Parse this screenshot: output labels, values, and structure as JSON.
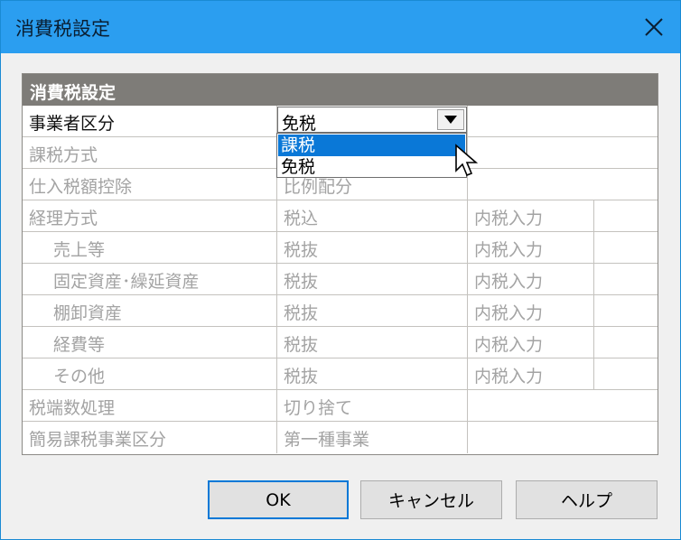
{
  "window": {
    "title": "消費税設定"
  },
  "panel": {
    "header": "消費税設定"
  },
  "combo": {
    "value": "免税",
    "options": [
      "課税",
      "免税"
    ],
    "highlighted": "課税"
  },
  "rows": [
    {
      "label": "事業者区分",
      "value": "",
      "input": ""
    },
    {
      "label": "課税方式",
      "value": "",
      "input": ""
    },
    {
      "label": "仕入税額控除",
      "value": "比例配分",
      "input": ""
    },
    {
      "label": "経理方式",
      "value": "税込",
      "input": "内税入力"
    },
    {
      "label": "売上等",
      "value": "税抜",
      "input": "内税入力"
    },
    {
      "label": "固定資産･繰延資産",
      "value": "税抜",
      "input": "内税入力"
    },
    {
      "label": "棚卸資産",
      "value": "税抜",
      "input": "内税入力"
    },
    {
      "label": "経費等",
      "value": "税抜",
      "input": "内税入力"
    },
    {
      "label": "その他",
      "value": "税抜",
      "input": "内税入力"
    },
    {
      "label": "税端数処理",
      "value": "切り捨て",
      "input": ""
    },
    {
      "label": "簡易課税事業区分",
      "value": "第一種事業",
      "input": ""
    }
  ],
  "buttons": {
    "ok": "OK",
    "cancel": "キャンセル",
    "help": "ヘルプ"
  },
  "icons": {
    "close": "close-icon",
    "dropdown": "chevron-down-icon",
    "cursor": "mouse-pointer-icon"
  },
  "colors": {
    "titlebar": "#2b9ef0",
    "header": "#7e7c78",
    "selection": "#0a78d7"
  }
}
